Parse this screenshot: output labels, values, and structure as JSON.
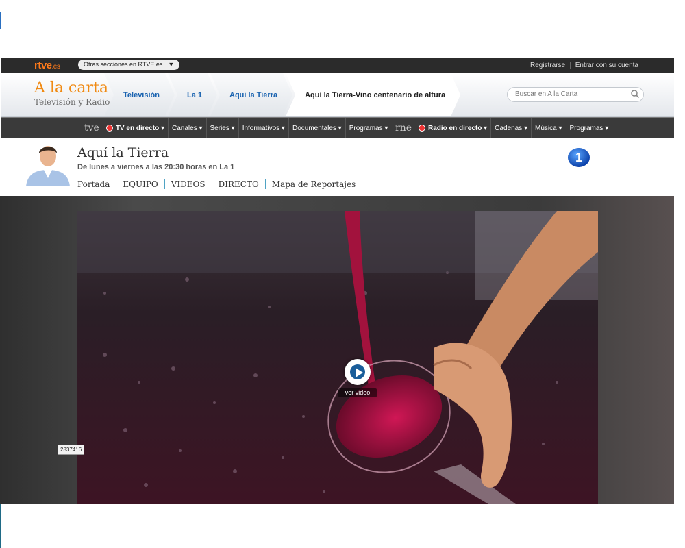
{
  "topbar": {
    "logo_main": "rtve",
    "logo_suffix": ".es",
    "sections_dropdown": "Otras secciones en RTVE.es",
    "register": "Registrarse",
    "login": "Entrar con su cuenta"
  },
  "header": {
    "brand_title": "A la carta",
    "brand_subtitle": "Televisión y Radio",
    "breadcrumbs": [
      "Televisión",
      "La 1",
      "Aquí la Tierra",
      "Aquí la Tierra-Vino centenario de altura"
    ],
    "search_placeholder": "Buscar en A la Carta"
  },
  "nav": {
    "tv_brand": "tve",
    "tv_live": "TV en directo",
    "tv_items": [
      "Canales",
      "Series",
      "Informativos",
      "Documentales",
      "Programas"
    ],
    "radio_brand": "rne",
    "radio_live": "Radio en directo",
    "radio_items": [
      "Cadenas",
      "Música",
      "Programas"
    ]
  },
  "program": {
    "title": "Aquí la Tierra",
    "schedule": "De lunes a viernes a las 20:30 horas en La 1",
    "menu": [
      "Portada",
      "EQUIPO",
      "VIDEOS",
      "DIRECTO",
      "Mapa de Reportajes"
    ],
    "channel_logo": "1"
  },
  "video": {
    "play_label": "ver video",
    "video_id": "2837416"
  },
  "colors": {
    "brand_orange": "#f08a13",
    "link_blue": "#1a63b0",
    "topbar": "#2b2b2b",
    "nav": "#3a3a3a"
  }
}
